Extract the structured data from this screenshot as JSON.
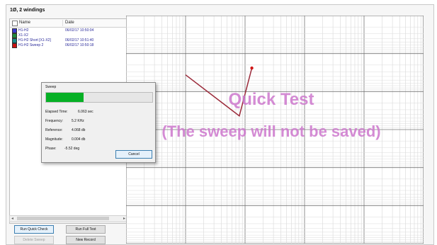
{
  "window": {
    "title": "1Ø, 2 windings"
  },
  "list": {
    "columns": [
      "Name",
      "Date"
    ],
    "rows": [
      {
        "name": "H1-H2",
        "date": "06/02/17 10:50:04",
        "color": "#3a3ad0"
      },
      {
        "name": "X1-X2",
        "date": "",
        "color": "#1e8a3a"
      },
      {
        "name": "H1-H2 Short [X1-X2]",
        "date": "06/02/17 10:51:40",
        "color": "#158a8a"
      },
      {
        "name": "H1-H2 Sweep 2",
        "date": "06/02/17 10:50:18",
        "color": "#cc1111"
      }
    ]
  },
  "buttons": {
    "run_quick_check": "Run Quick Check",
    "run_full_test": "Run Full Test",
    "delete_sweep": "Delete Sweep",
    "new_record": "New Record"
  },
  "chart": {
    "watermark_title": "Quick Test",
    "watermark_subtitle": "(The sweep will not be saved)",
    "title_color": "#cc77cc",
    "trace_color": "#9b2a3a"
  },
  "chart_data": {
    "type": "line",
    "x_scale": "log",
    "y_scale": "linear",
    "grid": true,
    "series": [
      {
        "x": [
          0.01,
          0.045,
          0.08,
          0.13
        ],
        "y": [
          0.74,
          0.61,
          0.56,
          0.77
        ]
      }
    ]
  },
  "dialog": {
    "title": "Sweep",
    "progress": 0.35,
    "elapsed_label": "Elapsed Time:",
    "elapsed_value": "6.063 sec",
    "frequency_label": "Frequency:",
    "frequency_value": "5.2 KHz",
    "reference_label": "Reference:",
    "reference_value": "4.068 db",
    "magnitude_label": "Magnitude:",
    "magnitude_value": "0.004 db",
    "phase_label": "Phase:",
    "phase_value": "-5.52 deg",
    "cancel_label": "Cancel"
  }
}
